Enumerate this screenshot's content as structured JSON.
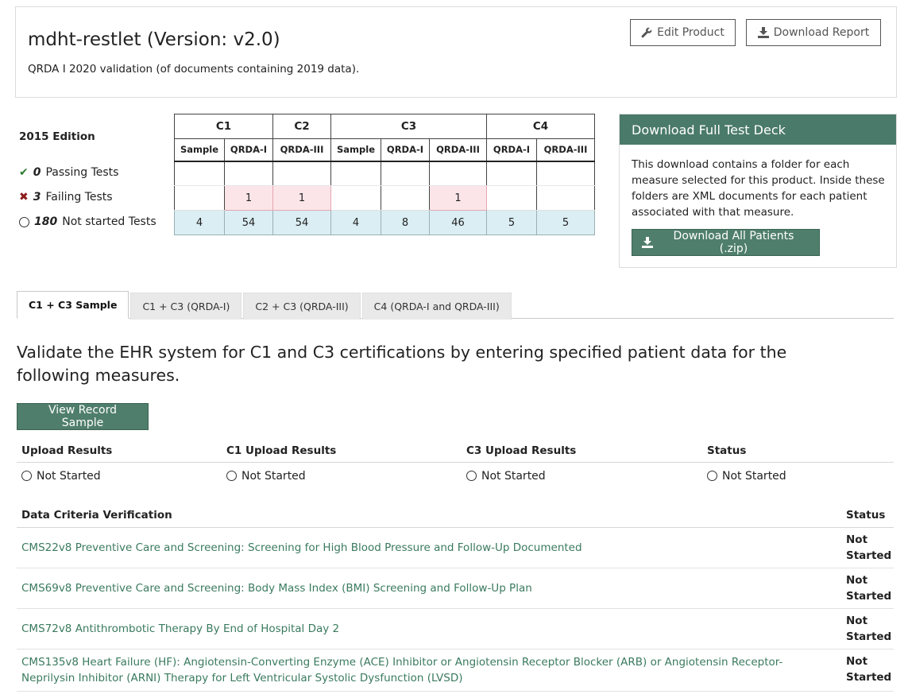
{
  "product": {
    "title": "mdht-restlet (Version: v2.0)",
    "description": "QRDA I 2020 validation (of documents containing 2019 data).",
    "edit_label": "Edit Product",
    "download_label": "Download Report"
  },
  "matrix": {
    "edition": "2015 Edition",
    "groups": [
      "C1",
      "C2",
      "C3",
      "C4"
    ],
    "subheaders": [
      "Sample",
      "QRDA-I",
      "QRDA-III",
      "Sample",
      "QRDA-I",
      "QRDA-III",
      "QRDA-I",
      "QRDA-III"
    ],
    "passing": {
      "count": "0",
      "label": "Passing Tests",
      "cells": [
        "",
        "",
        "",
        "",
        "",
        "",
        "",
        ""
      ]
    },
    "failing": {
      "count": "3",
      "label": "Failing Tests",
      "cells": [
        "",
        "1",
        "1",
        "",
        "",
        "1",
        "",
        ""
      ]
    },
    "not_started": {
      "count": "180",
      "label": "Not started Tests",
      "cells": [
        "4",
        "54",
        "54",
        "4",
        "8",
        "46",
        "5",
        "5"
      ]
    }
  },
  "deck": {
    "title": "Download Full Test Deck",
    "body": "This download contains a folder for each measure selected for this product. Inside these folders are XML documents for each patient associated with that measure.",
    "button": "Download All Patients (.zip)"
  },
  "tabs": [
    {
      "label": "C1 + C3 Sample",
      "active": true
    },
    {
      "label": "C1 + C3 (QRDA-I)",
      "active": false
    },
    {
      "label": "C2 + C3 (QRDA-III)",
      "active": false
    },
    {
      "label": "C4 (QRDA-I and QRDA-III)",
      "active": false
    }
  ],
  "validate_text": "Validate the EHR system for C1 and C3 certifications by entering specified patient data for the following measures.",
  "view_record_button": "View Record Sample",
  "upload": {
    "headers": [
      "Upload Results",
      "C1 Upload Results",
      "C3 Upload Results",
      "Status"
    ],
    "values": [
      "Not Started",
      "Not Started",
      "Not Started",
      "Not Started"
    ]
  },
  "criteria": {
    "header": "Data Criteria Verification",
    "status_header": "Status",
    "rows": [
      {
        "name": "CMS22v8 Preventive Care and Screening: Screening for High Blood Pressure and Follow-Up Documented",
        "status": "Not Started"
      },
      {
        "name": "CMS69v8 Preventive Care and Screening: Body Mass Index (BMI) Screening and Follow-Up Plan",
        "status": "Not Started"
      },
      {
        "name": "CMS72v8 Antithrombotic Therapy By End of Hospital Day 2",
        "status": "Not Started"
      },
      {
        "name": "CMS135v8 Heart Failure (HF): Angiotensin-Converting Enzyme (ACE) Inhibitor or Angiotensin Receptor Blocker (ARB) or Angiotensin Receptor-Neprilysin Inhibitor (ARNI) Therapy for Left Ventricular Systolic Dysfunction (LVSD)",
        "status": "Not Started"
      }
    ]
  }
}
